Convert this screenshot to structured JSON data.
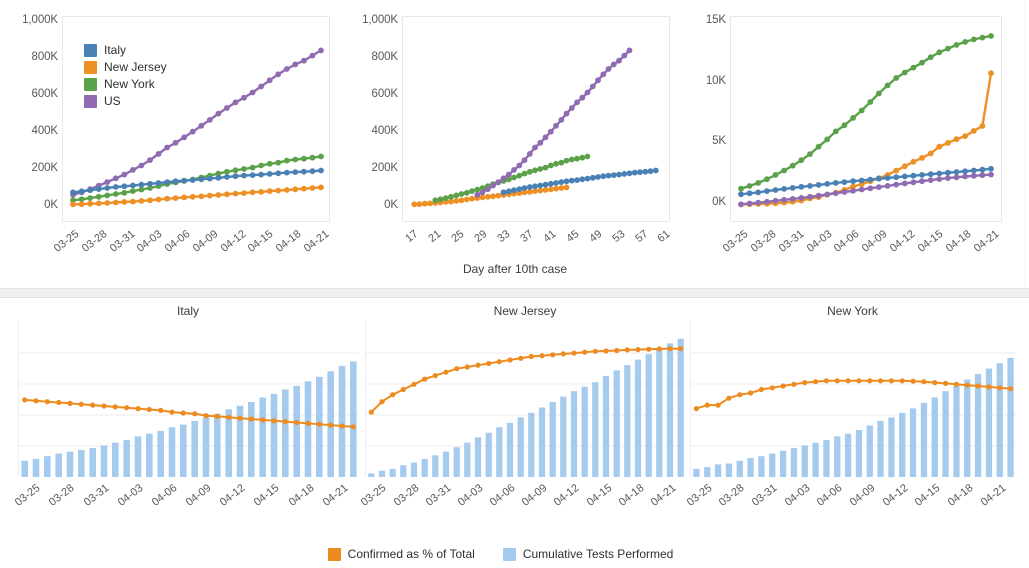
{
  "colors": {
    "italy": "#4a81b4",
    "new_jersey": "#ed9026",
    "new_york": "#5ba14a",
    "us": "#8f6bb1",
    "bar_blue": "#a4caee",
    "axis_text": "#55595d",
    "grid": "#ededed",
    "divider": "#f0f0f0"
  },
  "top": {
    "chart1": {
      "ylabels": [
        "1,000K",
        "800K",
        "600K",
        "400K",
        "200K",
        "0K"
      ],
      "xlabels": [
        "03-25",
        "03-28",
        "03-31",
        "04-03",
        "04-06",
        "04-09",
        "04-12",
        "04-15",
        "04-18",
        "04-21"
      ],
      "legend": [
        {
          "label": "Italy",
          "color": "#4a81b4"
        },
        {
          "label": "New Jersey",
          "color": "#ed9026"
        },
        {
          "label": "New York",
          "color": "#5ba14a"
        },
        {
          "label": "US",
          "color": "#8f6bb1"
        }
      ]
    },
    "chart2": {
      "ylabels": [
        "1,000K",
        "800K",
        "600K",
        "400K",
        "200K",
        "0K"
      ],
      "xlabels": [
        "17",
        "21",
        "25",
        "29",
        "33",
        "37",
        "41",
        "45",
        "49",
        "53",
        "57",
        "61"
      ],
      "axis_title": "Day after 10th case"
    },
    "chart3": {
      "ylabels": [
        "15K",
        "10K",
        "5K",
        "0K"
      ],
      "xlabels": [
        "03-25",
        "03-28",
        "03-31",
        "04-03",
        "04-06",
        "04-09",
        "04-12",
        "04-15",
        "04-18",
        "04-21"
      ]
    }
  },
  "bottom": {
    "facets": [
      "Italy",
      "New Jersey",
      "New York"
    ],
    "xlabels": [
      "03-25",
      "03-28",
      "03-31",
      "04-03",
      "04-06",
      "04-09",
      "04-12",
      "04-15",
      "04-18",
      "04-21"
    ],
    "legend": [
      {
        "label": "Confirmed as % of Total",
        "color": "#ed8b1f"
      },
      {
        "label": "Cumulative Tests Performed",
        "color": "#a4caee"
      }
    ]
  },
  "chart_data": [
    {
      "id": "cumulative-confirmed-by-date",
      "type": "line",
      "title": "",
      "xlabel": "",
      "ylabel": "",
      "ylim": [
        0,
        1000000
      ],
      "grid": false,
      "legend_position": "top-left",
      "x": [
        "03-24",
        "03-25",
        "03-26",
        "03-27",
        "03-28",
        "03-29",
        "03-30",
        "03-31",
        "04-01",
        "04-02",
        "04-03",
        "04-04",
        "04-05",
        "04-06",
        "04-07",
        "04-08",
        "04-09",
        "04-10",
        "04-11",
        "04-12",
        "04-13",
        "04-14",
        "04-15",
        "04-16",
        "04-17",
        "04-18",
        "04-19",
        "04-20",
        "04-21",
        "04-22"
      ],
      "series": [
        {
          "name": "Italy",
          "color": "#4a81b4",
          "values": [
            69176,
            74386,
            80589,
            86498,
            92472,
            97689,
            101739,
            105792,
            110574,
            115242,
            119827,
            124632,
            128948,
            132547,
            135586,
            139422,
            143626,
            147577,
            152271,
            156363,
            159516,
            162488,
            165155,
            168941,
            172434,
            175925,
            178972,
            181228,
            183957,
            187327
          ]
        },
        {
          "name": "New Jersey",
          "color": "#ed9026",
          "values": [
            3675,
            4402,
            6876,
            8825,
            11124,
            13386,
            16636,
            18696,
            22255,
            25590,
            29895,
            34124,
            37505,
            41090,
            44416,
            47437,
            51027,
            54588,
            58151,
            61850,
            64584,
            68824,
            71030,
            75317,
            78467,
            81420,
            85301,
            88806,
            92387,
            95865
          ]
        },
        {
          "name": "New York",
          "color": "#5ba14a",
          "values": [
            25665,
            30811,
            37258,
            44635,
            52318,
            59513,
            66497,
            75795,
            83712,
            92381,
            102863,
            113704,
            122031,
            130689,
            138836,
            149316,
            159937,
            170512,
            180458,
            188694,
            195655,
            203020,
            214454,
            223691,
            229642,
            241041,
            247215,
            251690,
            257216,
            263460
          ]
        },
        {
          "name": "US",
          "color": "#8f6bb1",
          "values": [
            55225,
            68905,
            86018,
            105470,
            124686,
            144980,
            165258,
            190522,
            214467,
            243999,
            277473,
            312253,
            338004,
            368081,
            398496,
            430376,
            462686,
            496499,
            527228,
            557590,
            583254,
            611485,
            644188,
            677570,
            710272,
            738913,
            764265,
            784326,
            811865,
            840476
          ]
        }
      ]
    },
    {
      "id": "cumulative-confirmed-by-day-after-10th-case",
      "type": "line",
      "title": "",
      "xlabel": "Day after 10th case",
      "ylabel": "",
      "ylim": [
        0,
        1000000
      ],
      "xlim": [
        15,
        63
      ],
      "grid": false,
      "series": [
        {
          "name": "Italy",
          "color": "#4a81b4",
          "x_start": 33,
          "x_end": 62,
          "values": [
            69176,
            74386,
            80589,
            86498,
            92472,
            97689,
            101739,
            105792,
            110574,
            115242,
            119827,
            124632,
            128948,
            132547,
            135586,
            139422,
            143626,
            147577,
            152271,
            156363,
            159516,
            162488,
            165155,
            168941,
            172434,
            175925,
            178972,
            181228,
            183957,
            187327
          ]
        },
        {
          "name": "New Jersey",
          "color": "#ed9026",
          "x_start": 16,
          "x_end": 45,
          "values": [
            3675,
            4402,
            6876,
            8825,
            11124,
            13386,
            16636,
            18696,
            22255,
            25590,
            29895,
            34124,
            37505,
            41090,
            44416,
            47437,
            51027,
            54588,
            58151,
            61850,
            64584,
            68824,
            71030,
            75317,
            78467,
            81420,
            85301,
            88806,
            92387,
            95865
          ]
        },
        {
          "name": "New York",
          "color": "#5ba14a",
          "x_start": 20,
          "x_end": 49,
          "values": [
            25665,
            30811,
            37258,
            44635,
            52318,
            59513,
            66497,
            75795,
            83712,
            92381,
            102863,
            113704,
            122031,
            130689,
            138836,
            149316,
            159937,
            170512,
            180458,
            188694,
            195655,
            203020,
            214454,
            223691,
            229642,
            241041,
            247215,
            251690,
            257216,
            263460
          ]
        },
        {
          "name": "US",
          "color": "#8f6bb1",
          "x_start": 28,
          "x_end": 57,
          "values": [
            55225,
            68905,
            86018,
            105470,
            124686,
            144980,
            165258,
            190522,
            214467,
            243999,
            277473,
            312253,
            338004,
            368081,
            398496,
            430376,
            462686,
            496499,
            527228,
            557590,
            583254,
            611485,
            644188,
            677570,
            710272,
            738913,
            764265,
            784326,
            811865,
            840476
          ]
        }
      ]
    },
    {
      "id": "cumulative-deaths-by-date",
      "type": "line",
      "title": "",
      "xlabel": "",
      "ylabel": "",
      "ylim": [
        0,
        15000
      ],
      "grid": false,
      "x": [
        "03-24",
        "03-25",
        "03-26",
        "03-27",
        "03-28",
        "03-29",
        "03-30",
        "03-31",
        "04-01",
        "04-02",
        "04-03",
        "04-04",
        "04-05",
        "04-06",
        "04-07",
        "04-08",
        "04-09",
        "04-10",
        "04-11",
        "04-12",
        "04-13",
        "04-14",
        "04-15",
        "04-16",
        "04-17",
        "04-18",
        "04-19",
        "04-20",
        "04-21",
        "04-22"
      ],
      "series": [
        {
          "name": "Italy",
          "color": "#4a81b4",
          "values": [
            870,
            950,
            1030,
            1130,
            1220,
            1310,
            1390,
            1480,
            1560,
            1640,
            1720,
            1800,
            1870,
            1940,
            2000,
            2070,
            2140,
            2200,
            2270,
            2330,
            2390,
            2450,
            2510,
            2570,
            2630,
            2690,
            2750,
            2810,
            2880,
            2950
          ]
        },
        {
          "name": "New Jersey",
          "color": "#ed9026",
          "values": [
            44,
            62,
            81,
            108,
            140,
            198,
            267,
            355,
            537,
            646,
            846,
            1003,
            1232,
            1504,
            1700,
            1932,
            2183,
            2443,
            2805,
            3156,
            3518,
            3840,
            4202,
            4753,
            5063,
            5368,
            5617,
            6044,
            6442,
            10747
          ]
        },
        {
          "name": "New York",
          "color": "#5ba14a",
          "values": [
            1325,
            1550,
            1800,
            2100,
            2450,
            2810,
            3200,
            3650,
            4150,
            4750,
            5350,
            6000,
            6500,
            7100,
            7700,
            8400,
            9100,
            9750,
            10350,
            10800,
            11200,
            11600,
            12050,
            12450,
            12750,
            13050,
            13300,
            13500,
            13650,
            13780
          ]
        },
        {
          "name": "US",
          "color": "#8f6bb1",
          "values": [
            60,
            120,
            190,
            260,
            340,
            420,
            500,
            580,
            670,
            760,
            860,
            960,
            1060,
            1160,
            1260,
            1360,
            1460,
            1560,
            1660,
            1760,
            1850,
            1940,
            2030,
            2110,
            2190,
            2260,
            2320,
            2380,
            2430,
            2480
          ]
        }
      ]
    },
    {
      "id": "tests-and-confirmed-pct-facets",
      "type": "bar",
      "title": "",
      "xlabel": "",
      "ylabel": "",
      "grid": true,
      "legend_position": "bottom-center",
      "categories": [
        "03-24",
        "03-25",
        "03-26",
        "03-27",
        "03-28",
        "03-29",
        "03-30",
        "03-31",
        "04-01",
        "04-02",
        "04-03",
        "04-04",
        "04-05",
        "04-06",
        "04-07",
        "04-08",
        "04-09",
        "04-10",
        "04-11",
        "04-12",
        "04-13",
        "04-14",
        "04-15",
        "04-16",
        "04-17",
        "04-18",
        "04-19",
        "04-20",
        "04-21",
        "04-22"
      ],
      "facets": [
        {
          "name": "Italy",
          "bars": {
            "name": "Cumulative Tests Performed",
            "color": "#a4caee",
            "values": [
              18,
              20,
              23,
              26,
              28,
              30,
              32,
              35,
              38,
              41,
              45,
              48,
              51,
              55,
              58,
              62,
              66,
              70,
              75,
              79,
              83,
              88,
              92,
              97,
              101,
              106,
              111,
              117,
              123,
              128
            ]
          },
          "line": {
            "name": "Confirmed as % of Total",
            "color": "#ed8b1f",
            "values": [
              49,
              48.5,
              48,
              47.5,
              47,
              46.5,
              46,
              45.5,
              45,
              44.5,
              44,
              43.5,
              43,
              42,
              41.5,
              41,
              40,
              39.5,
              39,
              38.5,
              38,
              37.5,
              37,
              36.5,
              36,
              35.5,
              35,
              34.5,
              34,
              33.5
            ]
          }
        },
        {
          "name": "New Jersey",
          "bars": {
            "name": "Cumulative Tests Performed",
            "color": "#a4caee",
            "values": [
              4,
              7,
              9,
              13,
              16,
              20,
              24,
              28,
              33,
              38,
              44,
              49,
              55,
              60,
              66,
              71,
              77,
              83,
              89,
              95,
              100,
              105,
              112,
              118,
              124,
              130,
              136,
              142,
              148,
              153
            ]
          },
          "line": {
            "name": "Confirmed as % of Total",
            "color": "#ed8b1f",
            "values": [
              42,
              48,
              52,
              55,
              58,
              61,
              63,
              65,
              67,
              68,
              69,
              70,
              71,
              72,
              73,
              74,
              74.5,
              75,
              75.5,
              76,
              76.5,
              77,
              77.2,
              77.5,
              77.8,
              78,
              78.2,
              78.4,
              78.5,
              78.6
            ]
          }
        },
        {
          "name": "New York",
          "bars": {
            "name": "Cumulative Tests Performed",
            "color": "#a4caee",
            "values": [
              9,
              11,
              14,
              15,
              18,
              21,
              23,
              26,
              29,
              32,
              35,
              38,
              41,
              45,
              48,
              52,
              57,
              62,
              66,
              71,
              76,
              82,
              88,
              95,
              101,
              108,
              114,
              120,
              126,
              132
            ]
          },
          "line": {
            "name": "Confirmed as % of Total",
            "color": "#ed8b1f",
            "values": [
              44,
              46,
              46,
              50,
              52,
              53,
              55,
              56,
              57,
              58,
              59,
              59.5,
              60,
              60,
              60,
              60,
              60,
              60,
              60,
              60,
              59.8,
              59.5,
              59,
              58.5,
              58,
              57.5,
              57,
              56.5,
              56,
              55.5
            ]
          }
        }
      ]
    }
  ]
}
